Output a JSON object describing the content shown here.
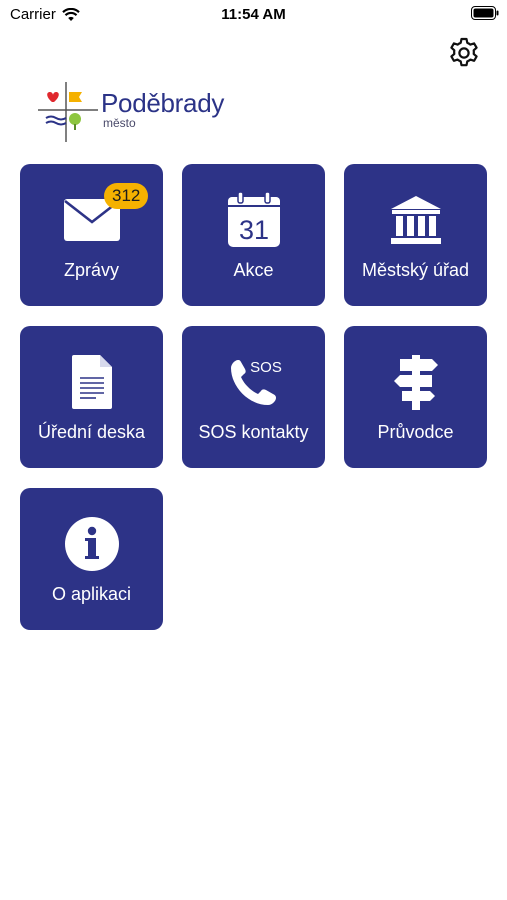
{
  "status_bar": {
    "carrier": "Carrier",
    "time": "11:54 AM"
  },
  "app": {
    "logo_name": "Poděbrady",
    "logo_sub": "město",
    "settings_icon": "gear-icon"
  },
  "tiles": [
    {
      "label": "Zprávy",
      "icon": "envelope-icon",
      "badge": "312"
    },
    {
      "label": "Akce",
      "icon": "calendar-icon",
      "calendar_day": "31"
    },
    {
      "label": "Městský úřad",
      "icon": "town-hall-icon"
    },
    {
      "label": "Úřední deska",
      "icon": "document-icon"
    },
    {
      "label": "SOS kontakty",
      "icon": "phone-sos-icon",
      "icon_text": "SOS"
    },
    {
      "label": "Průvodce",
      "icon": "signpost-icon"
    },
    {
      "label": "O aplikaci",
      "icon": "info-icon"
    }
  ],
  "colors": {
    "tile_bg": "#2d3387",
    "badge": "#f5b100",
    "logo_text": "#2b3387"
  }
}
